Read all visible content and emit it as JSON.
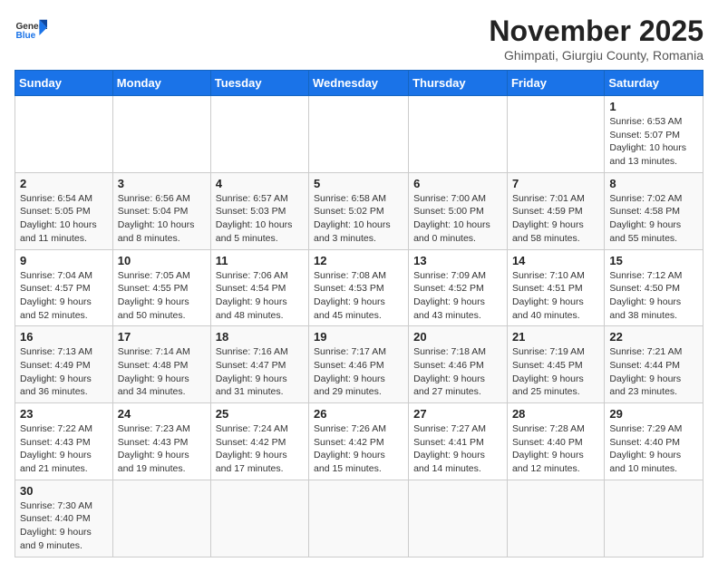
{
  "logo": {
    "text_general": "General",
    "text_blue": "Blue"
  },
  "title": "November 2025",
  "subtitle": "Ghimpati, Giurgiu County, Romania",
  "days_of_week": [
    "Sunday",
    "Monday",
    "Tuesday",
    "Wednesday",
    "Thursday",
    "Friday",
    "Saturday"
  ],
  "weeks": [
    [
      {
        "day": null,
        "info": null
      },
      {
        "day": null,
        "info": null
      },
      {
        "day": null,
        "info": null
      },
      {
        "day": null,
        "info": null
      },
      {
        "day": null,
        "info": null
      },
      {
        "day": null,
        "info": null
      },
      {
        "day": "1",
        "info": "Sunrise: 6:53 AM\nSunset: 5:07 PM\nDaylight: 10 hours and 13 minutes."
      }
    ],
    [
      {
        "day": "2",
        "info": "Sunrise: 6:54 AM\nSunset: 5:05 PM\nDaylight: 10 hours and 11 minutes."
      },
      {
        "day": "3",
        "info": "Sunrise: 6:56 AM\nSunset: 5:04 PM\nDaylight: 10 hours and 8 minutes."
      },
      {
        "day": "4",
        "info": "Sunrise: 6:57 AM\nSunset: 5:03 PM\nDaylight: 10 hours and 5 minutes."
      },
      {
        "day": "5",
        "info": "Sunrise: 6:58 AM\nSunset: 5:02 PM\nDaylight: 10 hours and 3 minutes."
      },
      {
        "day": "6",
        "info": "Sunrise: 7:00 AM\nSunset: 5:00 PM\nDaylight: 10 hours and 0 minutes."
      },
      {
        "day": "7",
        "info": "Sunrise: 7:01 AM\nSunset: 4:59 PM\nDaylight: 9 hours and 58 minutes."
      },
      {
        "day": "8",
        "info": "Sunrise: 7:02 AM\nSunset: 4:58 PM\nDaylight: 9 hours and 55 minutes."
      }
    ],
    [
      {
        "day": "9",
        "info": "Sunrise: 7:04 AM\nSunset: 4:57 PM\nDaylight: 9 hours and 52 minutes."
      },
      {
        "day": "10",
        "info": "Sunrise: 7:05 AM\nSunset: 4:55 PM\nDaylight: 9 hours and 50 minutes."
      },
      {
        "day": "11",
        "info": "Sunrise: 7:06 AM\nSunset: 4:54 PM\nDaylight: 9 hours and 48 minutes."
      },
      {
        "day": "12",
        "info": "Sunrise: 7:08 AM\nSunset: 4:53 PM\nDaylight: 9 hours and 45 minutes."
      },
      {
        "day": "13",
        "info": "Sunrise: 7:09 AM\nSunset: 4:52 PM\nDaylight: 9 hours and 43 minutes."
      },
      {
        "day": "14",
        "info": "Sunrise: 7:10 AM\nSunset: 4:51 PM\nDaylight: 9 hours and 40 minutes."
      },
      {
        "day": "15",
        "info": "Sunrise: 7:12 AM\nSunset: 4:50 PM\nDaylight: 9 hours and 38 minutes."
      }
    ],
    [
      {
        "day": "16",
        "info": "Sunrise: 7:13 AM\nSunset: 4:49 PM\nDaylight: 9 hours and 36 minutes."
      },
      {
        "day": "17",
        "info": "Sunrise: 7:14 AM\nSunset: 4:48 PM\nDaylight: 9 hours and 34 minutes."
      },
      {
        "day": "18",
        "info": "Sunrise: 7:16 AM\nSunset: 4:47 PM\nDaylight: 9 hours and 31 minutes."
      },
      {
        "day": "19",
        "info": "Sunrise: 7:17 AM\nSunset: 4:46 PM\nDaylight: 9 hours and 29 minutes."
      },
      {
        "day": "20",
        "info": "Sunrise: 7:18 AM\nSunset: 4:46 PM\nDaylight: 9 hours and 27 minutes."
      },
      {
        "day": "21",
        "info": "Sunrise: 7:19 AM\nSunset: 4:45 PM\nDaylight: 9 hours and 25 minutes."
      },
      {
        "day": "22",
        "info": "Sunrise: 7:21 AM\nSunset: 4:44 PM\nDaylight: 9 hours and 23 minutes."
      }
    ],
    [
      {
        "day": "23",
        "info": "Sunrise: 7:22 AM\nSunset: 4:43 PM\nDaylight: 9 hours and 21 minutes."
      },
      {
        "day": "24",
        "info": "Sunrise: 7:23 AM\nSunset: 4:43 PM\nDaylight: 9 hours and 19 minutes."
      },
      {
        "day": "25",
        "info": "Sunrise: 7:24 AM\nSunset: 4:42 PM\nDaylight: 9 hours and 17 minutes."
      },
      {
        "day": "26",
        "info": "Sunrise: 7:26 AM\nSunset: 4:42 PM\nDaylight: 9 hours and 15 minutes."
      },
      {
        "day": "27",
        "info": "Sunrise: 7:27 AM\nSunset: 4:41 PM\nDaylight: 9 hours and 14 minutes."
      },
      {
        "day": "28",
        "info": "Sunrise: 7:28 AM\nSunset: 4:40 PM\nDaylight: 9 hours and 12 minutes."
      },
      {
        "day": "29",
        "info": "Sunrise: 7:29 AM\nSunset: 4:40 PM\nDaylight: 9 hours and 10 minutes."
      }
    ],
    [
      {
        "day": "30",
        "info": "Sunrise: 7:30 AM\nSunset: 4:40 PM\nDaylight: 9 hours and 9 minutes."
      },
      {
        "day": null,
        "info": null
      },
      {
        "day": null,
        "info": null
      },
      {
        "day": null,
        "info": null
      },
      {
        "day": null,
        "info": null
      },
      {
        "day": null,
        "info": null
      },
      {
        "day": null,
        "info": null
      }
    ]
  ]
}
